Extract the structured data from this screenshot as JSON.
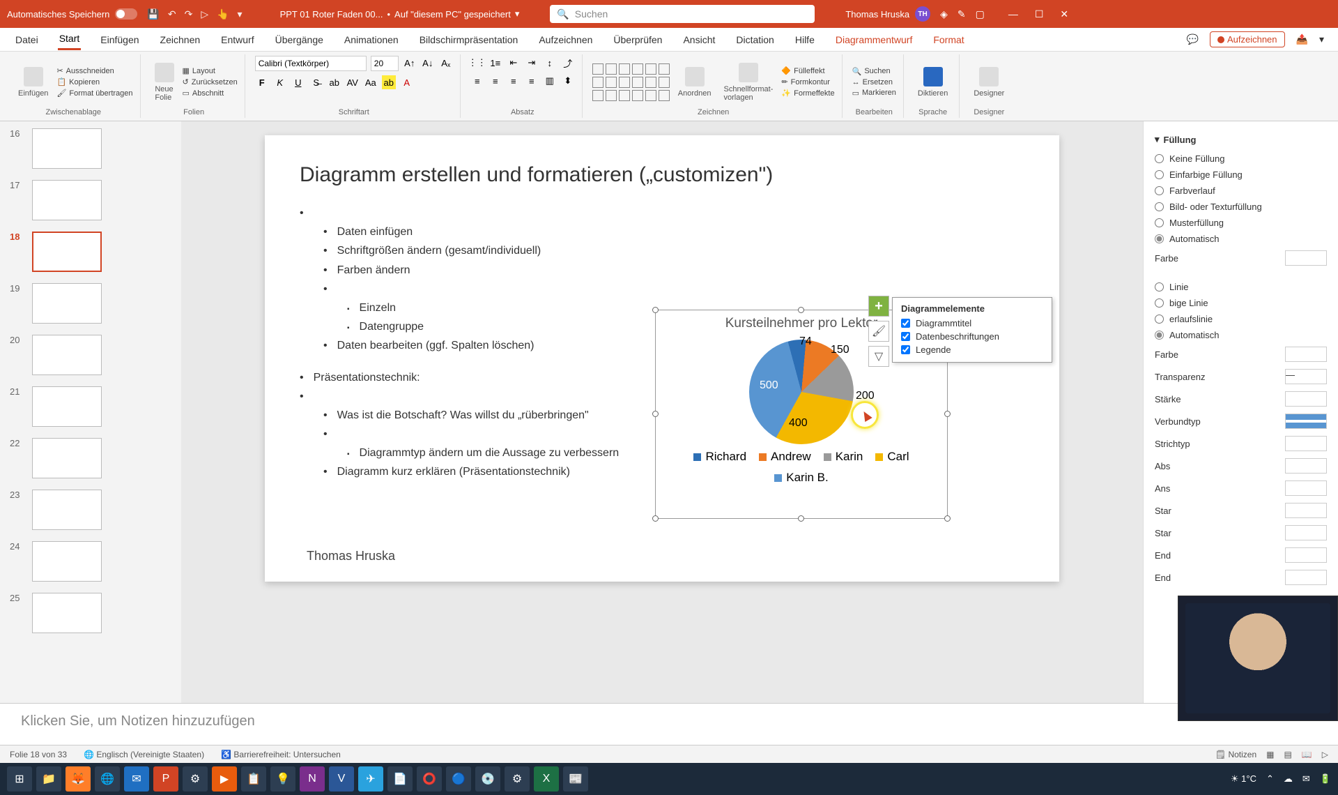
{
  "titlebar": {
    "autosave": "Automatisches Speichern",
    "filename": "PPT 01 Roter Faden 00...",
    "saved_location": "Auf \"diesem PC\" gespeichert",
    "search_placeholder": "Suchen",
    "user_name": "Thomas Hruska",
    "user_initials": "TH"
  },
  "tabs": {
    "items": [
      "Datei",
      "Start",
      "Einfügen",
      "Zeichnen",
      "Entwurf",
      "Übergänge",
      "Animationen",
      "Bildschirmpräsentation",
      "Aufzeichnen",
      "Überprüfen",
      "Ansicht",
      "Dictation",
      "Hilfe",
      "Diagrammentwurf",
      "Format"
    ],
    "active": "Start",
    "record_button": "Aufzeichnen"
  },
  "ribbon": {
    "clipboard": {
      "paste": "Einfügen",
      "cut": "Ausschneiden",
      "copy": "Kopieren",
      "format": "Format übertragen",
      "label": "Zwischenablage"
    },
    "slides": {
      "new": "Neue\nFolie",
      "layout": "Layout",
      "reset": "Zurücksetzen",
      "section": "Abschnitt",
      "label": "Folien"
    },
    "font": {
      "name": "Calibri (Textkörper)",
      "size": "20",
      "label": "Schriftart"
    },
    "paragraph": {
      "label": "Absatz"
    },
    "drawing": {
      "arrange": "Anordnen",
      "quick": "Schnellformat-\nvorlagen",
      "fill": "Fülleffekt",
      "outline": "Formkontur",
      "effects": "Formeffekte",
      "label": "Zeichnen"
    },
    "editing": {
      "find": "Suchen",
      "replace": "Ersetzen",
      "select": "Markieren",
      "label": "Bearbeiten"
    },
    "voice": {
      "dictate": "Diktieren",
      "label": "Sprache"
    },
    "designer": {
      "btn": "Designer",
      "label": "Designer"
    }
  },
  "thumbnails": [
    {
      "num": "16"
    },
    {
      "num": "17"
    },
    {
      "num": "18",
      "active": true
    },
    {
      "num": "19"
    },
    {
      "num": "20"
    },
    {
      "num": "21"
    },
    {
      "num": "22"
    },
    {
      "num": "23"
    },
    {
      "num": "24"
    },
    {
      "num": "25"
    }
  ],
  "slide": {
    "title": "Diagramm erstellen und formatieren („customizen\")",
    "bullets1": {
      "a": "Daten einfügen",
      "b": "Schriftgrößen ändern (gesamt/individuell)",
      "c": "Farben ändern",
      "c1": "Einzeln",
      "c2": "Datengruppe",
      "d": "Daten bearbeiten (ggf. Spalten löschen)"
    },
    "bullets2": {
      "head": "Präsentationstechnik:",
      "a": "Was ist die Botschaft? Was willst du „rüberbringen\"",
      "b": "Diagrammtyp ändern um die Aussage zu verbessern",
      "c": "Diagramm kurz erklären (Präsentationstechnik)"
    },
    "author": "Thomas Hruska"
  },
  "chart_data": {
    "type": "pie",
    "title": "Kursteilnehmer pro Lektor",
    "categories": [
      "Richard",
      "Andrew",
      "Karin",
      "Carl",
      "Karin B."
    ],
    "values": [
      74,
      150,
      200,
      400,
      500
    ],
    "colors": [
      "#2d6fb5",
      "#ec7a24",
      "#9a9a9a",
      "#f3b800",
      "#5895d1"
    ],
    "legend_position": "bottom",
    "data_labels": true
  },
  "chart_elements_popup": {
    "title": "Diagrammelemente",
    "opt1": "Diagrammtitel",
    "opt2": "Datenbeschriftungen",
    "opt3": "Legende"
  },
  "format_pane": {
    "fill_section": "Füllung",
    "fill_opts": [
      "Keine Füllung",
      "Einfarbige Füllung",
      "Farbverlauf",
      "Bild- oder Texturfüllung",
      "Musterfüllung",
      "Automatisch"
    ],
    "fill_selected": "Automatisch",
    "color_label": "Farbe",
    "line_opts": [
      "Linie",
      "bige Linie",
      "erlaufslinie",
      "Automatisch"
    ],
    "color_label2": "Farbe",
    "transparency": "Transparenz",
    "width": "Stärke",
    "compound": "Verbundtyp",
    "dash": "Strichtyp",
    "truncated": [
      "Abs",
      "Ans",
      "Star",
      "Star",
      "End",
      "End"
    ]
  },
  "notes_placeholder": "Klicken Sie, um Notizen hinzuzufügen",
  "statusbar": {
    "slide": "Folie 18 von 33",
    "lang": "Englisch (Vereinigte Staaten)",
    "access": "Barrierefreiheit: Untersuchen",
    "notes": "Notizen"
  },
  "taskbar": {
    "weather": "1°C"
  }
}
